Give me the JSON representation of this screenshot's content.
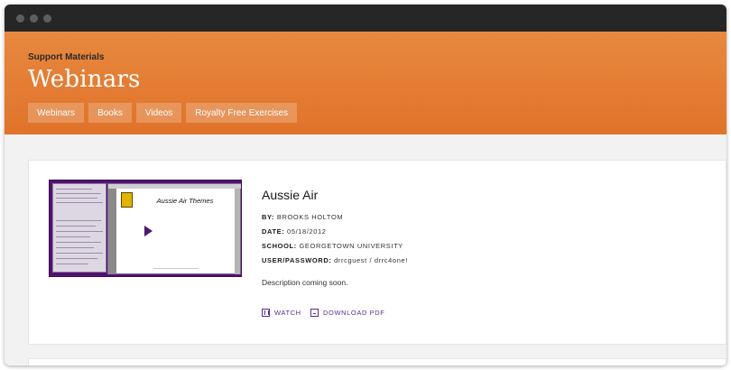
{
  "window": {
    "controls": [
      "close",
      "minimize",
      "maximize"
    ]
  },
  "hero": {
    "eyebrow": "Support Materials",
    "title": "Webinars",
    "tabs": [
      "Webinars",
      "Books",
      "Videos",
      "Royalty Free Exercises"
    ]
  },
  "webinar": {
    "thumbnail": {
      "slide_title": "Aussie Air Themes"
    },
    "title": "Aussie Air",
    "by_label": "BY:",
    "by_value": "BROOKS HOLTOM",
    "date_label": "DATE:",
    "date_value": "05/18/2012",
    "school_label": "SCHOOL:",
    "school_value": "GEORGETOWN UNIVERSITY",
    "credentials_label": "USER/PASSWORD:",
    "credentials_value": "drrcguest / drrc4one!",
    "description": "Description coming soon.",
    "watch_label": "WATCH",
    "download_label": "DOWNLOAD PDF"
  },
  "colors": {
    "accent": "#e07a32",
    "link": "#5a2f8a",
    "thumbnail_frame": "#52136f"
  }
}
